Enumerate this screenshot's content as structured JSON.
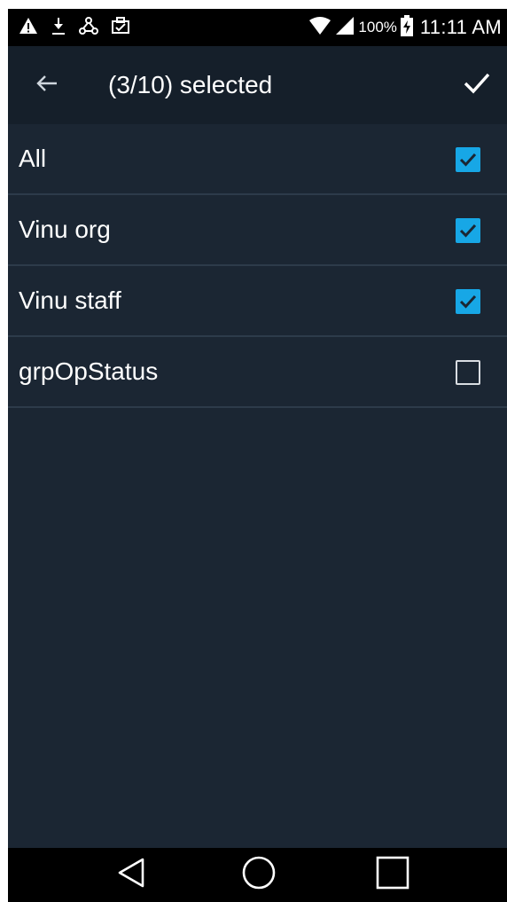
{
  "status_bar": {
    "icons_left": [
      "warning-icon",
      "download-icon",
      "network-icon",
      "briefcase-icon"
    ],
    "icons_right": [
      "wifi-icon",
      "signal-icon",
      "battery-charging-icon"
    ],
    "battery_text": "100%",
    "time": "11:11 AM"
  },
  "appbar": {
    "title": "(3/10) selected",
    "back_icon": "arrow-left-icon",
    "done_icon": "check-icon"
  },
  "list": [
    {
      "label": "All",
      "checked": true
    },
    {
      "label": "Vinu org",
      "checked": true
    },
    {
      "label": "Vinu staff",
      "checked": true
    },
    {
      "label": "grpOpStatus",
      "checked": false
    }
  ],
  "nav_bar": {
    "icons": [
      "back-triangle-icon",
      "home-circle-icon",
      "recents-square-icon"
    ]
  },
  "colors": {
    "background": "#1b2633",
    "appbar": "#151f2a",
    "accent": "#17a7e6",
    "divider": "#2d3b4a"
  }
}
